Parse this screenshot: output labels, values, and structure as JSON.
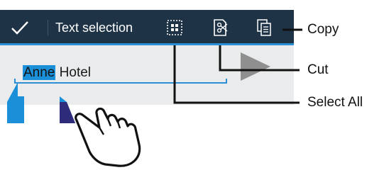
{
  "action_bar": {
    "title": "Text selection",
    "icons": [
      "check-icon",
      "select-all-icon",
      "cut-icon",
      "copy-icon"
    ]
  },
  "text_field": {
    "selected_text": "Anne",
    "rest_text": " Hotel"
  },
  "callouts": {
    "copy": "Copy",
    "cut": "Cut",
    "select_all": "Select All"
  },
  "colors": {
    "action_bar": "#1f3346",
    "accent": "#2b8fd4",
    "content_bg": "#e9ebec",
    "handle": "#1c8fd9"
  }
}
